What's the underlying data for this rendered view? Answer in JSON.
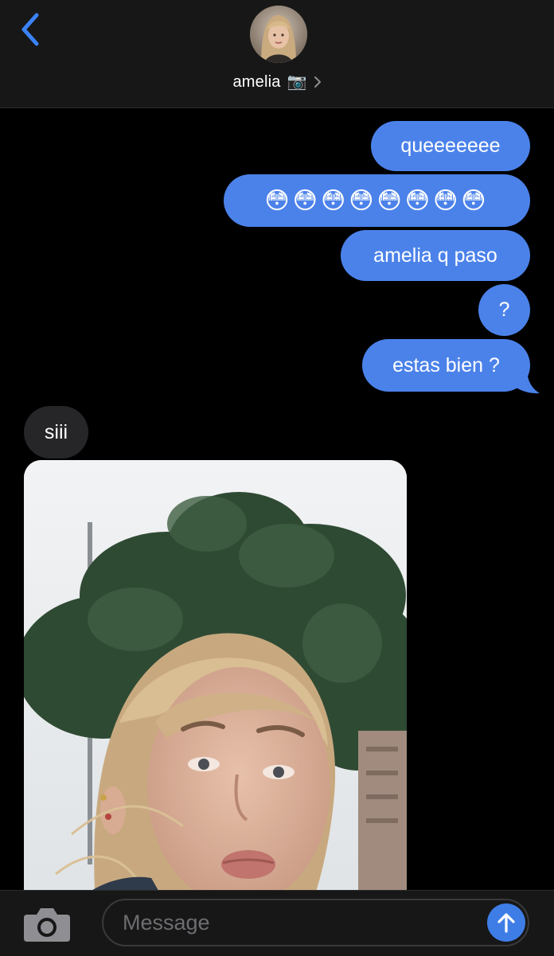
{
  "header": {
    "contact_name": "amelia",
    "camera_emoji": "📷",
    "icons": [
      "chevron-left-icon",
      "camera-emoji-icon",
      "chevron-right-icon"
    ]
  },
  "messages": [
    {
      "direction": "outgoing",
      "text": "queeeeeee"
    },
    {
      "direction": "outgoing",
      "text": "😳😳😳😳😳😳😳😳"
    },
    {
      "direction": "outgoing",
      "text": "amelia q paso"
    },
    {
      "direction": "outgoing",
      "text": "?"
    },
    {
      "direction": "outgoing",
      "text": "estas bien ?"
    },
    {
      "direction": "incoming",
      "text": "siii"
    }
  ],
  "attachment": {
    "type": "photo",
    "description_icon": "photo-attachment"
  },
  "composer": {
    "placeholder": "Message",
    "value": ""
  },
  "colors": {
    "outgoing_bubble": "#4b82ea",
    "incoming_bubble": "#262628",
    "accent": "#3f7de6",
    "background": "#000000",
    "bar": "#171717"
  }
}
